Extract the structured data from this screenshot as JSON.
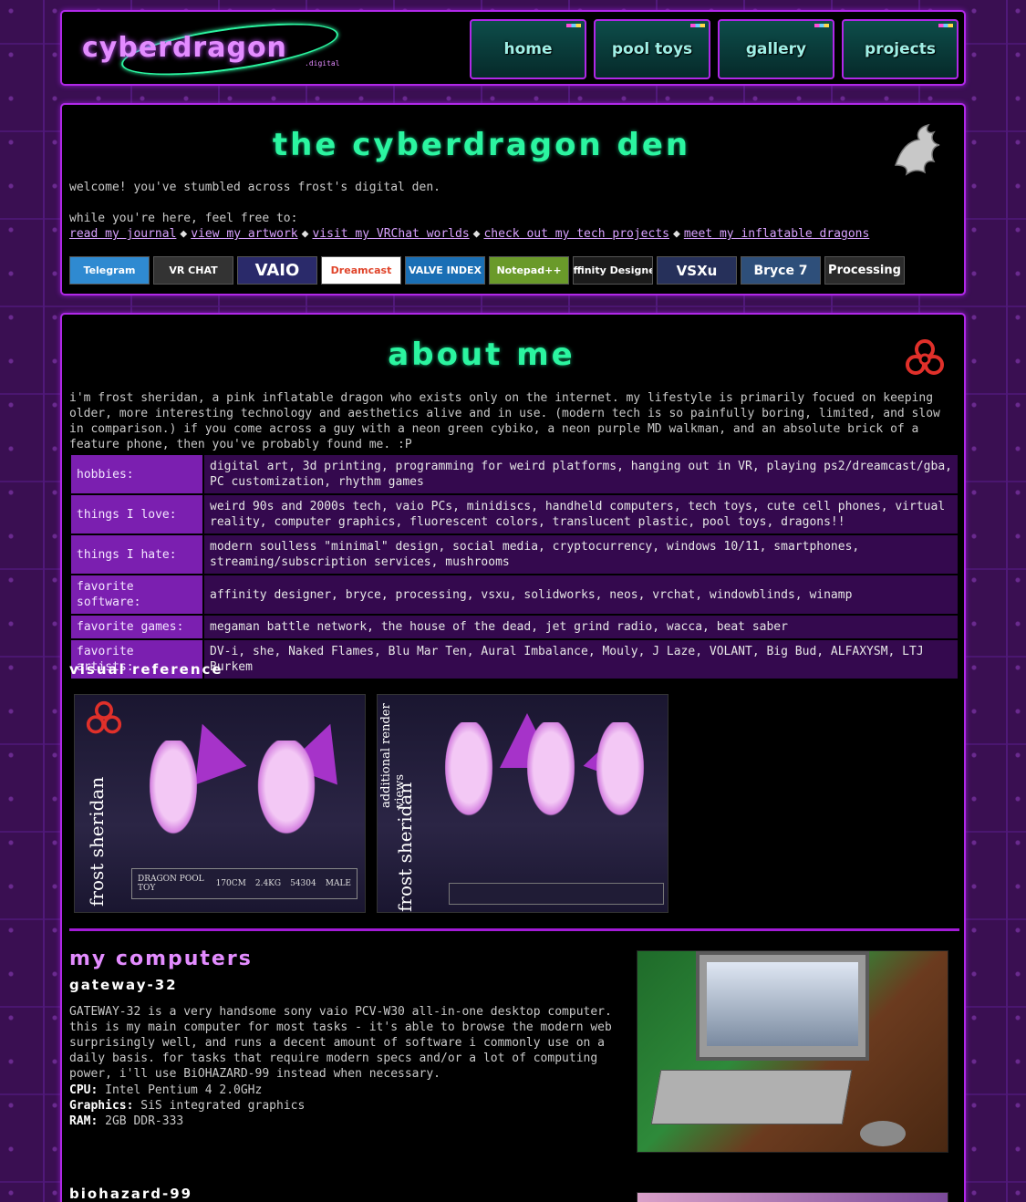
{
  "header": {
    "logo_text": "cyberdragon",
    "logo_sub": ".digital",
    "nav": [
      "home",
      "pool toys",
      "gallery",
      "projects"
    ]
  },
  "welcome": {
    "title": "the cyberdragon den",
    "intro": "welcome! you've stumbled across frost's digital den.",
    "lead": "while you're here, feel free to:",
    "links": [
      "read my journal",
      "view my artwork",
      "visit my VRChat worlds",
      "check out my tech projects",
      "meet my inflatable dragons"
    ],
    "badges": [
      "Telegram",
      "VR CHAT",
      "VAIO",
      "Dreamcast",
      "VALVE INDEX",
      "Notepad++",
      "Affinity Designer",
      "VSXu",
      "Bryce 7",
      "Processing"
    ],
    "badge_colors": [
      "#2f8ad1",
      "#333333",
      "#2a2a6a",
      "#ffffff",
      "#1a6fb5",
      "#6a9a2a",
      "#1b1b1b",
      "#26305a",
      "#2e4f7a",
      "#2b2b2b"
    ]
  },
  "about": {
    "title": "about me",
    "bio": "i'm frost sheridan, a pink inflatable dragon who exists only on the internet. my lifestyle is primarily focued on keeping older, more interesting technology and aesthetics alive and in use. (modern tech is so painfully boring, limited, and slow in comparison.) if you come across a guy with a neon green cybiko, a neon purple MD walkman, and an absolute brick of a feature phone, then you've probably found me. :P",
    "table": [
      {
        "k": "hobbies:",
        "v": "digital art, 3d printing, programming for weird platforms, hanging out in VR, playing ps2/dreamcast/gba, PC customization, rhythm games"
      },
      {
        "k": "things I love:",
        "v": "weird 90s and 2000s tech, vaio PCs, minidiscs, handheld computers, tech toys, cute cell phones, virtual reality, computer graphics, fluorescent colors, translucent plastic, pool toys, dragons!!"
      },
      {
        "k": "things I hate:",
        "v": "modern soulless \"minimal\" design, social media, cryptocurrency, windows 10/11, smartphones, streaming/subscription services, mushrooms"
      },
      {
        "k": "favorite software:",
        "v": "affinity designer, bryce, processing, vsxu, solidworks, neos, vrchat, windowblinds, winamp"
      },
      {
        "k": "favorite games:",
        "v": "megaman battle network, the house of the dead, jet grind radio, wacca, beat saber"
      },
      {
        "k": "favorite artists:",
        "v": "DV-i, she, Naked Flames, Blu Mar Ten, Aural Imbalance, Mouly, J Laze, VOLANT, Big Bud, ALFAXYSM, LTJ Burkem"
      }
    ],
    "visual_ref_heading": "visual reference",
    "ref1_name": "frost sheridan",
    "ref2_name": "frost sheridan",
    "ref2_caption": "additional render views",
    "ref1_stats": [
      "DRAGON POOL TOY",
      "170CM",
      "2.4KG",
      "54304",
      "MALE"
    ]
  },
  "computers": {
    "heading": "my computers",
    "gateway_title": "gateway-32",
    "gateway_desc": "GATEWAY-32 is a very handsome sony vaio PCV-W30 all-in-one desktop computer. this is my main computer for most tasks - it's able to browse the modern web surprisingly well, and runs a decent amount of software i commonly use on a daily basis. for tasks that require modern specs and/or a lot of computing power, i'll use BiOHAZARD-99 instead when necessary.",
    "specs": [
      {
        "label": "CPU:",
        "value": "Intel Pentium 4 2.0GHz"
      },
      {
        "label": "Graphics:",
        "value": "SiS integrated graphics"
      },
      {
        "label": "RAM:",
        "value": "2GB DDR-333"
      }
    ],
    "biohazard_title": "biohazard-99"
  }
}
